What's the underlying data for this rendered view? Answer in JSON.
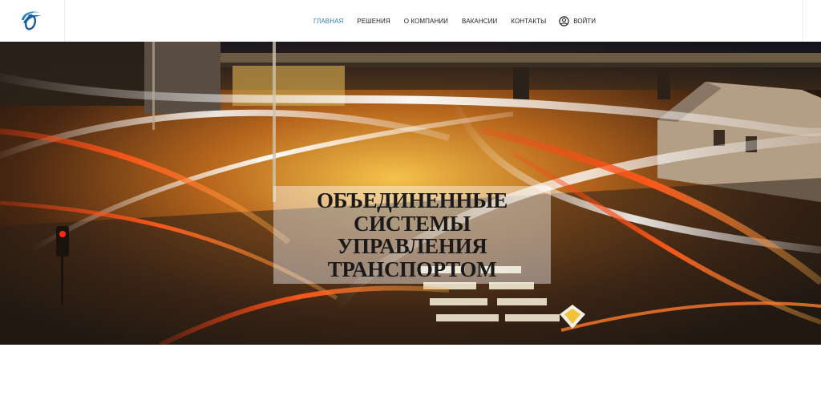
{
  "header": {
    "logo_icon": "company-logo-swoosh",
    "nav": [
      {
        "label": "Главная",
        "active": true
      },
      {
        "label": "Решения",
        "active": false
      },
      {
        "label": "О компании",
        "active": false
      },
      {
        "label": "Вакансии",
        "active": false
      },
      {
        "label": "Контакты",
        "active": false
      }
    ],
    "login": {
      "label": "Войти",
      "icon": "user-circle-icon"
    },
    "colors": {
      "active": "#2f7fbe",
      "text": "#222222"
    }
  },
  "hero": {
    "title_lines": [
      "Объединенные",
      "системы",
      "управления",
      "транспортом"
    ],
    "background": "night city intersection with light trails"
  }
}
